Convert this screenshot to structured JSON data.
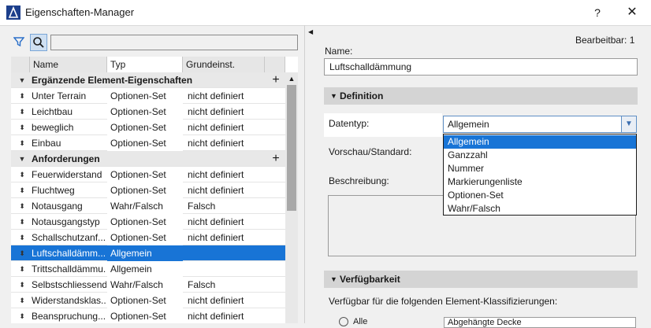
{
  "window": {
    "title": "Eigenschaften-Manager",
    "help_label": "?",
    "close_label": "✕"
  },
  "toolbar": {
    "search_placeholder": ""
  },
  "table": {
    "headers": {
      "name": "Name",
      "type": "Typ",
      "default": "Grundeinst."
    },
    "rows": [
      {
        "kind": "group",
        "name": "Ergänzende Element-Eigenschaften",
        "type": "",
        "default": ""
      },
      {
        "kind": "item",
        "name": "Unter Terrain",
        "type": "Optionen-Set",
        "default": "nicht definiert"
      },
      {
        "kind": "item",
        "name": "Leichtbau",
        "type": "Optionen-Set",
        "default": "nicht definiert"
      },
      {
        "kind": "item",
        "name": "beweglich",
        "type": "Optionen-Set",
        "default": "nicht definiert"
      },
      {
        "kind": "item",
        "name": "Einbau",
        "type": "Optionen-Set",
        "default": "nicht definiert"
      },
      {
        "kind": "group",
        "name": "Anforderungen",
        "type": "",
        "default": ""
      },
      {
        "kind": "item",
        "name": "Feuerwiderstand",
        "type": "Optionen-Set",
        "default": "nicht definiert"
      },
      {
        "kind": "item",
        "name": "Fluchtweg",
        "type": "Optionen-Set",
        "default": "nicht definiert"
      },
      {
        "kind": "item",
        "name": "Notausgang",
        "type": "Wahr/Falsch",
        "default": "Falsch"
      },
      {
        "kind": "item",
        "name": "Notausgangstyp",
        "type": "Optionen-Set",
        "default": "nicht definiert"
      },
      {
        "kind": "item",
        "name": "Schallschutzanf...",
        "type": "Optionen-Set",
        "default": "nicht definiert"
      },
      {
        "kind": "selected",
        "name": "Luftschalldämm...",
        "type": "Allgemein",
        "default": ""
      },
      {
        "kind": "item",
        "name": "Trittschalldämmu...",
        "type": "Allgemein",
        "default": ""
      },
      {
        "kind": "item",
        "name": "Selbstschliessend",
        "type": "Wahr/Falsch",
        "default": "Falsch"
      },
      {
        "kind": "item",
        "name": "Widerstandsklas...",
        "type": "Optionen-Set",
        "default": "nicht definiert"
      },
      {
        "kind": "item",
        "name": "Beanspruchung...",
        "type": "Optionen-Set",
        "default": "nicht definiert"
      }
    ]
  },
  "details": {
    "editable": "Bearbeitbar: 1",
    "name_label": "Name:",
    "name_value": "Luftschalldämmung",
    "definition_header": "Definition",
    "datatype_label": "Datentyp:",
    "datatype_value": "Allgemein",
    "preview_label": "Vorschau/Standard:",
    "description_label": "Beschreibung:",
    "datatype_options": [
      "Allgemein",
      "Ganzzahl",
      "Nummer",
      "Markierungenliste",
      "Optionen-Set",
      "Wahr/Falsch"
    ],
    "availability_header": "Verfügbarkeit",
    "availability_label": "Verfügbar für die folgenden Element-Klassifizierungen:",
    "availability_radio": "Alle",
    "availability_field": "Abgehängte Decke"
  },
  "colors": {
    "selection": "#1874d6",
    "accent_border": "#5f8fc4"
  }
}
